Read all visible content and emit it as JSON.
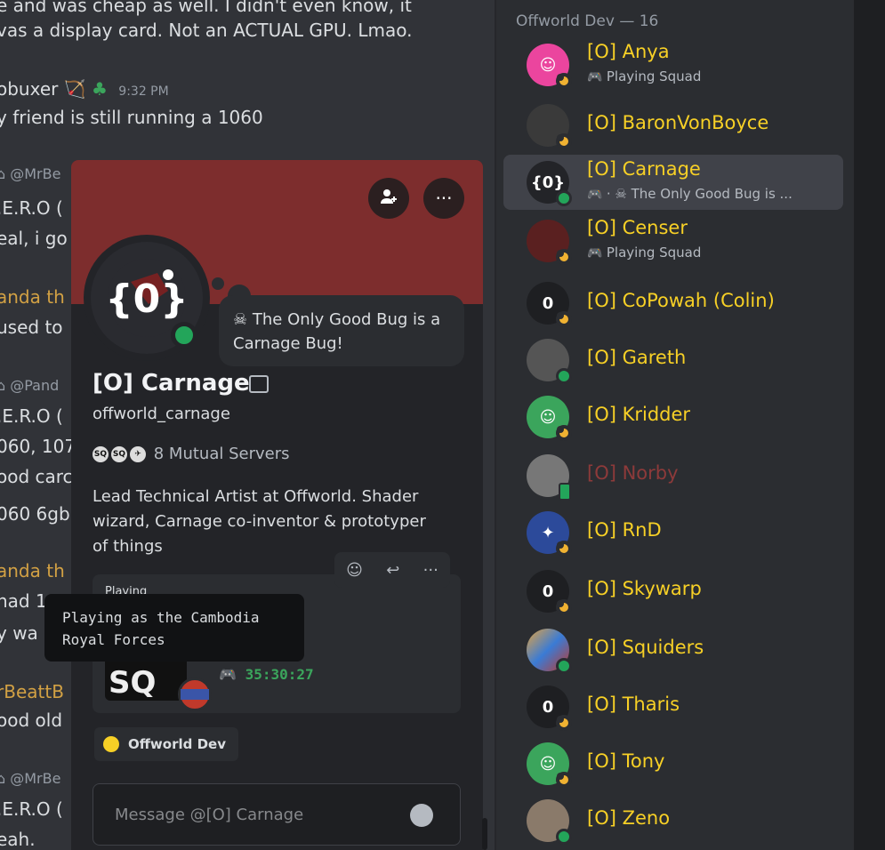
{
  "chat": {
    "lines": [
      {
        "text": "e and was cheap as well. I didn't even know, it"
      },
      {
        "text": "vas a display card. Not an ACTUAL GPU. Lmao."
      },
      {
        "text": "y friend is still running a 1060"
      },
      {
        "text": ".E.R.O ("
      },
      {
        "text": "eal, i go"
      },
      {
        "text": "used to"
      },
      {
        "text": ".E.R.O ("
      },
      {
        "text": "060, 107"
      },
      {
        "text": "ood carc"
      },
      {
        "text": "060 6gb"
      },
      {
        "text": "had 1"
      },
      {
        "text": "y wa"
      },
      {
        "text": "ood old"
      },
      {
        "text": ".E.R.O ("
      },
      {
        "text": "eah."
      }
    ],
    "author": "obuxer",
    "time": "9:32 PM",
    "replies": [
      "@MrBe",
      "@Pand",
      "@MrBe"
    ],
    "orange_names": [
      "anda th",
      "anda th",
      "rBeattB"
    ]
  },
  "members": {
    "header": "Offworld Dev — 16",
    "list": [
      {
        "name": "[O] Anya",
        "activity": "Playing Squad",
        "status": "idle",
        "avatar": "discord-pink"
      },
      {
        "name": "[O] BaronVonBoyce",
        "activity": "",
        "status": "idle",
        "avatar": "dark"
      },
      {
        "name": "[O] Carnage",
        "activity": "· ☠ The Only Good Bug is ...",
        "status": "online",
        "avatar": "carnage",
        "selected": true
      },
      {
        "name": "[O] Censer",
        "activity": "Playing Squad",
        "status": "idle",
        "avatar": "dark-red"
      },
      {
        "name": "[O] CoPowah (Colin)",
        "activity": "",
        "status": "idle",
        "avatar": "offworld"
      },
      {
        "name": "[O] Gareth",
        "activity": "",
        "status": "online",
        "avatar": "face"
      },
      {
        "name": "[O] Kridder",
        "activity": "",
        "status": "idle",
        "avatar": "discord-green"
      },
      {
        "name": "[O] Norby",
        "activity": "",
        "status": "mobile",
        "avatar": "bw",
        "offline": true
      },
      {
        "name": "[O] RnD",
        "activity": "",
        "status": "idle",
        "avatar": "eagle"
      },
      {
        "name": "[O] Skywarp",
        "activity": "",
        "status": "idle",
        "avatar": "offworld"
      },
      {
        "name": "[O] Squiders",
        "activity": "",
        "status": "online",
        "avatar": "colorful"
      },
      {
        "name": "[O] Tharis",
        "activity": "",
        "status": "idle",
        "avatar": "offworld"
      },
      {
        "name": "[O] Tony",
        "activity": "",
        "status": "idle",
        "avatar": "discord-green"
      },
      {
        "name": "[O] Zeno",
        "activity": "",
        "status": "online",
        "avatar": "face2"
      }
    ]
  },
  "profile": {
    "display_name": "[O] Carnage",
    "username": "offworld_carnage",
    "custom_status": "The Only Good Bug is a Carnage Bug!",
    "mutual_servers": "8 Mutual Servers",
    "bio": "Lead Technical Artist at Offworld. Shader wizard, Carnage co-inventor & prototyper of things",
    "activity_header": "Playing",
    "activity_timer": "35:30:27",
    "activity_image_text": "SQ",
    "tooltip": "Playing as the Cambodia Royal Forces",
    "server_chip": "Offworld Dev",
    "message_placeholder": "Message @[O] Carnage",
    "banner_color": "#7d2d2d"
  }
}
